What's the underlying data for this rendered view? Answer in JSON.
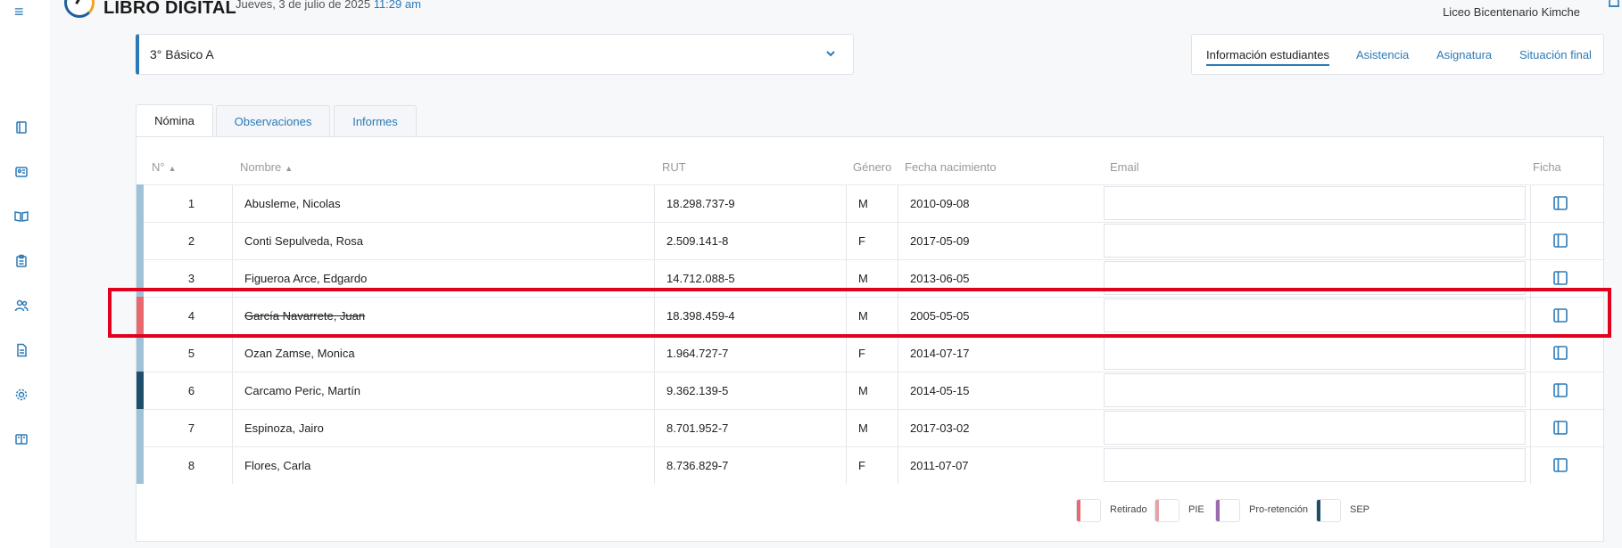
{
  "header": {
    "brand": "LIBRO DIGITAL",
    "date": "Jueves, 3 de julio de 2025",
    "time": "11:29 am",
    "school": "Liceo Bicentenario Kimche"
  },
  "sidebar": {
    "items": [
      {
        "icon": "book-icon"
      },
      {
        "icon": "id-card-icon"
      },
      {
        "icon": "open-book-icon"
      },
      {
        "icon": "clipboard-icon"
      },
      {
        "icon": "users-icon"
      },
      {
        "icon": "document-icon"
      },
      {
        "icon": "gear-icon"
      },
      {
        "icon": "library-icon"
      }
    ]
  },
  "course_select": {
    "value": "3° Básico A"
  },
  "topnav": {
    "items": [
      "Información estudiantes",
      "Asistencia",
      "Asignatura",
      "Situación final"
    ],
    "active": "Información estudiantes"
  },
  "tabs": {
    "items": [
      "Nómina",
      "Observaciones",
      "Informes"
    ],
    "active": "Nómina"
  },
  "table": {
    "headers": {
      "num": "N°",
      "name": "Nombre",
      "rut": "RUT",
      "gender": "Género",
      "birth": "Fecha nacimiento",
      "email": "Email",
      "ficha": "Ficha"
    },
    "rows": [
      {
        "num": "1",
        "name": "Abusleme, Nicolas",
        "rut": "18.298.737-9",
        "gender": "M",
        "birth": "2010-09-08",
        "email": "",
        "status_color": "#9ec3d9",
        "withdrawn": false
      },
      {
        "num": "2",
        "name": "Conti Sepulveda, Rosa",
        "rut": "2.509.141-8",
        "gender": "F",
        "birth": "2017-05-09",
        "email": "",
        "status_color": "#9ec3d9",
        "withdrawn": false
      },
      {
        "num": "3",
        "name": "Figueroa Arce, Edgardo",
        "rut": "14.712.088-5",
        "gender": "M",
        "birth": "2013-06-05",
        "email": "",
        "status_color": "#9ec3d9",
        "withdrawn": false
      },
      {
        "num": "4",
        "name": "García Navarrete, Juan",
        "rut": "18.398.459-4",
        "gender": "M",
        "birth": "2005-05-05",
        "email": "",
        "status_color": "#e8686e",
        "withdrawn": true
      },
      {
        "num": "5",
        "name": "Ozan Zamse, Monica",
        "rut": "1.964.727-7",
        "gender": "F",
        "birth": "2014-07-17",
        "email": "",
        "status_color": "#9ec3d9",
        "withdrawn": false
      },
      {
        "num": "6",
        "name": "Carcamo Peric, Martín",
        "rut": "9.362.139-5",
        "gender": "M",
        "birth": "2014-05-15",
        "email": "",
        "status_color": "#1f4e6b",
        "withdrawn": false
      },
      {
        "num": "7",
        "name": "Espinoza, Jairo",
        "rut": "8.701.952-7",
        "gender": "M",
        "birth": "2017-03-02",
        "email": "",
        "status_color": "#9ec3d9",
        "withdrawn": false
      },
      {
        "num": "8",
        "name": "Flores, Carla",
        "rut": "8.736.829-7",
        "gender": "F",
        "birth": "2011-07-07",
        "email": "",
        "status_color": "#9ec3d9",
        "withdrawn": false
      }
    ]
  },
  "legend": [
    {
      "label": "Retirado",
      "color": "#e8686e"
    },
    {
      "label": "PIE",
      "color": "#e3a3a8"
    },
    {
      "label": "Pro-retención",
      "color": "#9b6bb0"
    },
    {
      "label": "SEP",
      "color": "#1f4e6b"
    }
  ]
}
